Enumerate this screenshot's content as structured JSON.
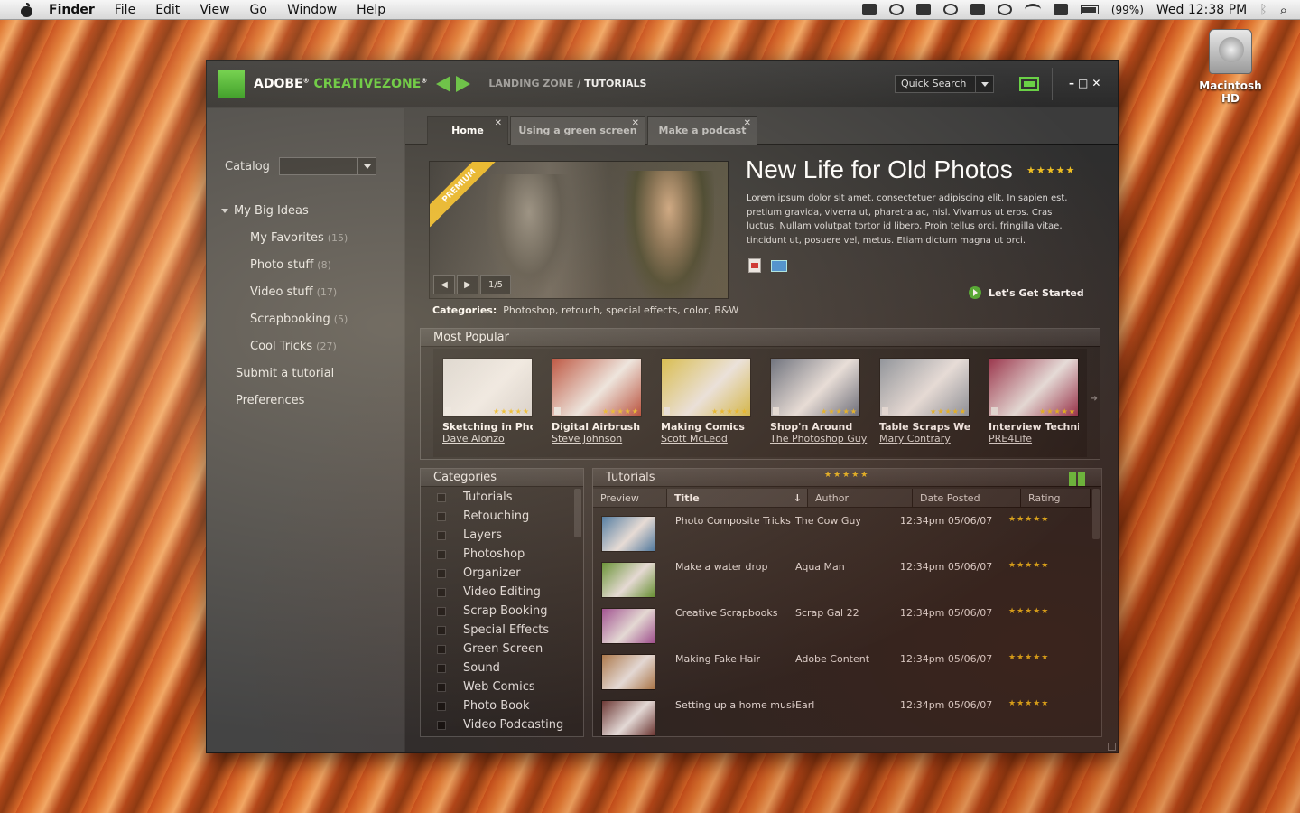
{
  "menubar": {
    "app": "Finder",
    "items": [
      "File",
      "Edit",
      "View",
      "Go",
      "Window",
      "Help"
    ],
    "battery": "(99%)",
    "clock": "Wed 12:38 PM"
  },
  "desktop": {
    "disk_label": "Macintosh HD"
  },
  "app": {
    "brand_adobe": "ADOBE",
    "brand_zone": "CREATIVEZONE",
    "crumb_first": "LANDING ZONE",
    "crumb_sep": " / ",
    "crumb_current": "TUTORIALS",
    "quick_search": "Quick Search",
    "window_controls": "–□✕"
  },
  "sidebar": {
    "catalog_label": "Catalog",
    "group": "My Big Ideas",
    "items": [
      {
        "label": "My Favorites",
        "count": "(15)"
      },
      {
        "label": "Photo stuff",
        "count": "(8)"
      },
      {
        "label": "Video stuff",
        "count": "(17)"
      },
      {
        "label": "Scrapbooking",
        "count": "(5)"
      },
      {
        "label": "Cool Tricks",
        "count": "(27)"
      }
    ],
    "links": [
      "Submit a tutorial",
      "Preferences"
    ]
  },
  "tabs": [
    {
      "label": "Home",
      "close": "✕"
    },
    {
      "label": "Using a green screen",
      "close": "✕"
    },
    {
      "label": "Make a podcast",
      "close": "✕"
    }
  ],
  "hero": {
    "ribbon": "PREMIUM",
    "page": "1/5",
    "title": "New Life for Old Photos",
    "stars": "★★★★★",
    "description": "Lorem ipsum dolor sit amet, consectetuer adipiscing elit. In sapien est, pretium gravida, viverra ut, pharetra ac, nisl. Vivamus ut eros. Cras luctus. Nullam volutpat tortor id libero. Proin tellus orci, fringilla vitae, tincidunt ut, posuere vel, metus. Etiam dictum magna ut orci.",
    "cta": "Let's Get Started",
    "categories_label": "Categories:",
    "categories": "Photoshop, retouch, special effects, color, B&W"
  },
  "most_popular": {
    "heading": "Most Popular",
    "items": [
      {
        "title": "Sketching in Pho...",
        "author": "Dave Alonzo",
        "stars": "★★★★★",
        "color": "#d8d8d8"
      },
      {
        "title": "Digital Airbrush",
        "author": "Steve Johnson",
        "stars": "★★★★★",
        "color": "#b23a2a"
      },
      {
        "title": "Making Comics",
        "author": "Scott McLeod",
        "stars": "★★★★★",
        "color": "#d8c040"
      },
      {
        "title": "Shop'n Around",
        "author": "The Photoshop Guy",
        "stars": "★★★★★",
        "color": "#5a6a80"
      },
      {
        "title": "Table Scraps Weekly",
        "author": "Mary Contrary",
        "stars": "★★★★★",
        "color": "#8a9aa8"
      },
      {
        "title": "Interview Techni..",
        "author": "PRE4Life",
        "stars": "★★★★★",
        "color": "#9a3050"
      }
    ]
  },
  "categories": {
    "heading": "Categories",
    "items": [
      "Tutorials",
      "Retouching",
      "Layers",
      "Photoshop",
      "Organizer",
      "Video Editing",
      "Scrap Booking",
      "Special Effects",
      "Green Screen",
      "Sound",
      "Web Comics",
      "Photo Book",
      "Video Podcasting"
    ]
  },
  "tutorials": {
    "heading": "Tutorials",
    "stars": "★★★★★",
    "columns": [
      "Preview",
      "Title",
      "Author",
      "Date Posted",
      "Rating"
    ],
    "sort_arrow": "↓",
    "rows": [
      {
        "title": "Photo Composite Tricks",
        "author": "The Cow Guy",
        "date": "12:34pm 05/06/07",
        "rating": "★★★★★",
        "color": "#3a7ab0"
      },
      {
        "title": "Make a water drop",
        "author": "Aqua Man",
        "date": "12:34pm 05/06/07",
        "rating": "★★★★★",
        "color": "#5a9a30"
      },
      {
        "title": "Creative Scrapbooks",
        "author": "Scrap Gal 22",
        "date": "12:34pm 05/06/07",
        "rating": "★★★★★",
        "color": "#a050a0"
      },
      {
        "title": "Making Fake Hair",
        "author": "Adobe  Content",
        "date": "12:34pm 05/06/07",
        "rating": "★★★★★",
        "color": "#b08050"
      },
      {
        "title": "Setting up a home music...",
        "author": "Earl",
        "date": "12:34pm 05/06/07",
        "rating": "★★★★★",
        "color": "#6a3a3a"
      }
    ]
  }
}
